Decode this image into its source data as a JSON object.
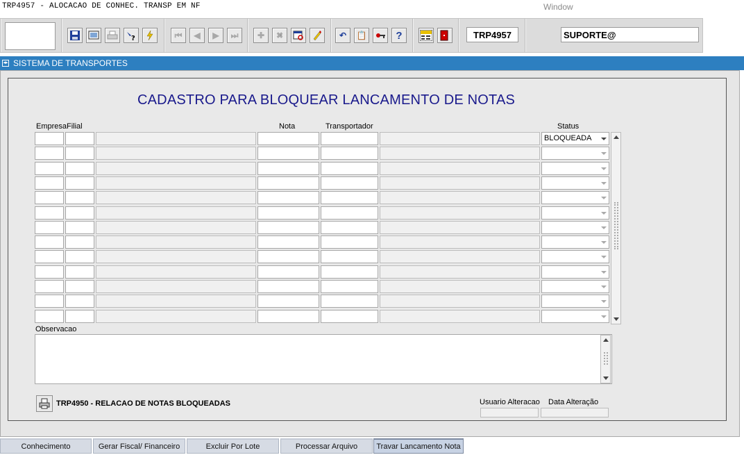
{
  "window": {
    "title": "TRP4957 - ALOCACAO DE  CONHEC. TRANSP EM NF",
    "menu_window": "Window"
  },
  "toolbar": {
    "icons": [
      "save-icon",
      "screen-icon",
      "printer-icon",
      "search-help-icon",
      "execute-query-icon",
      "first-record-icon",
      "previous-record-icon",
      "next-record-icon",
      "last-record-icon",
      "insert-record-icon",
      "delete-record-icon",
      "query-icon",
      "edit-icon",
      "undo-icon",
      "clipboard-icon",
      "key-icon",
      "help-icon",
      "menu-icon",
      "exit-icon"
    ],
    "help_glyph": "?",
    "menu_label": "Menu",
    "form_code": "TRP4957",
    "user": "SUPORTE@"
  },
  "breadcrumb": {
    "label": "SISTEMA DE TRANSPORTES"
  },
  "form": {
    "title": "CADASTRO PARA BLOQUEAR LANCAMENTO DE NOTAS",
    "columns": {
      "empresa": "Empresa",
      "filial": "Filial",
      "nota": "Nota",
      "transportador": "Transportador",
      "status": "Status"
    },
    "rows": [
      {
        "empresa": "",
        "filial": "",
        "descricao": "",
        "nota": "",
        "transportador": "",
        "nome_transportador": "",
        "status": "BLOQUEADA"
      },
      {
        "empresa": "",
        "filial": "",
        "descricao": "",
        "nota": "",
        "transportador": "",
        "nome_transportador": "",
        "status": ""
      },
      {
        "empresa": "",
        "filial": "",
        "descricao": "",
        "nota": "",
        "transportador": "",
        "nome_transportador": "",
        "status": ""
      },
      {
        "empresa": "",
        "filial": "",
        "descricao": "",
        "nota": "",
        "transportador": "",
        "nome_transportador": "",
        "status": ""
      },
      {
        "empresa": "",
        "filial": "",
        "descricao": "",
        "nota": "",
        "transportador": "",
        "nome_transportador": "",
        "status": ""
      },
      {
        "empresa": "",
        "filial": "",
        "descricao": "",
        "nota": "",
        "transportador": "",
        "nome_transportador": "",
        "status": ""
      },
      {
        "empresa": "",
        "filial": "",
        "descricao": "",
        "nota": "",
        "transportador": "",
        "nome_transportador": "",
        "status": ""
      },
      {
        "empresa": "",
        "filial": "",
        "descricao": "",
        "nota": "",
        "transportador": "",
        "nome_transportador": "",
        "status": ""
      },
      {
        "empresa": "",
        "filial": "",
        "descricao": "",
        "nota": "",
        "transportador": "",
        "nome_transportador": "",
        "status": ""
      },
      {
        "empresa": "",
        "filial": "",
        "descricao": "",
        "nota": "",
        "transportador": "",
        "nome_transportador": "",
        "status": ""
      },
      {
        "empresa": "",
        "filial": "",
        "descricao": "",
        "nota": "",
        "transportador": "",
        "nome_transportador": "",
        "status": ""
      },
      {
        "empresa": "",
        "filial": "",
        "descricao": "",
        "nota": "",
        "transportador": "",
        "nome_transportador": "",
        "status": ""
      },
      {
        "empresa": "",
        "filial": "",
        "descricao": "",
        "nota": "",
        "transportador": "",
        "nome_transportador": "",
        "status": ""
      }
    ],
    "observacao_label": "Observacao",
    "observacao_value": "",
    "report_button_label": "TRP4950 - RELACAO DE NOTAS BLOQUEADAS",
    "usuario_alteracao_label": "Usuario Alteracao",
    "usuario_alteracao_value": "",
    "data_alteracao_label": "Data Alteração",
    "data_alteracao_value": ""
  },
  "tabs": [
    {
      "label": "Conhecimento",
      "active": false
    },
    {
      "label": "Gerar Fiscal/ Financeiro",
      "active": false
    },
    {
      "label": "Excluir Por Lote",
      "active": false
    },
    {
      "label": "Processar Arquivo",
      "active": false
    },
    {
      "label": "Travar Lancamento Nota",
      "active": true
    }
  ],
  "colors": {
    "breadcrumb_bg": "#2d7fc0",
    "title_color": "#1a1a8c",
    "active_tab": "#c8d3e4"
  }
}
